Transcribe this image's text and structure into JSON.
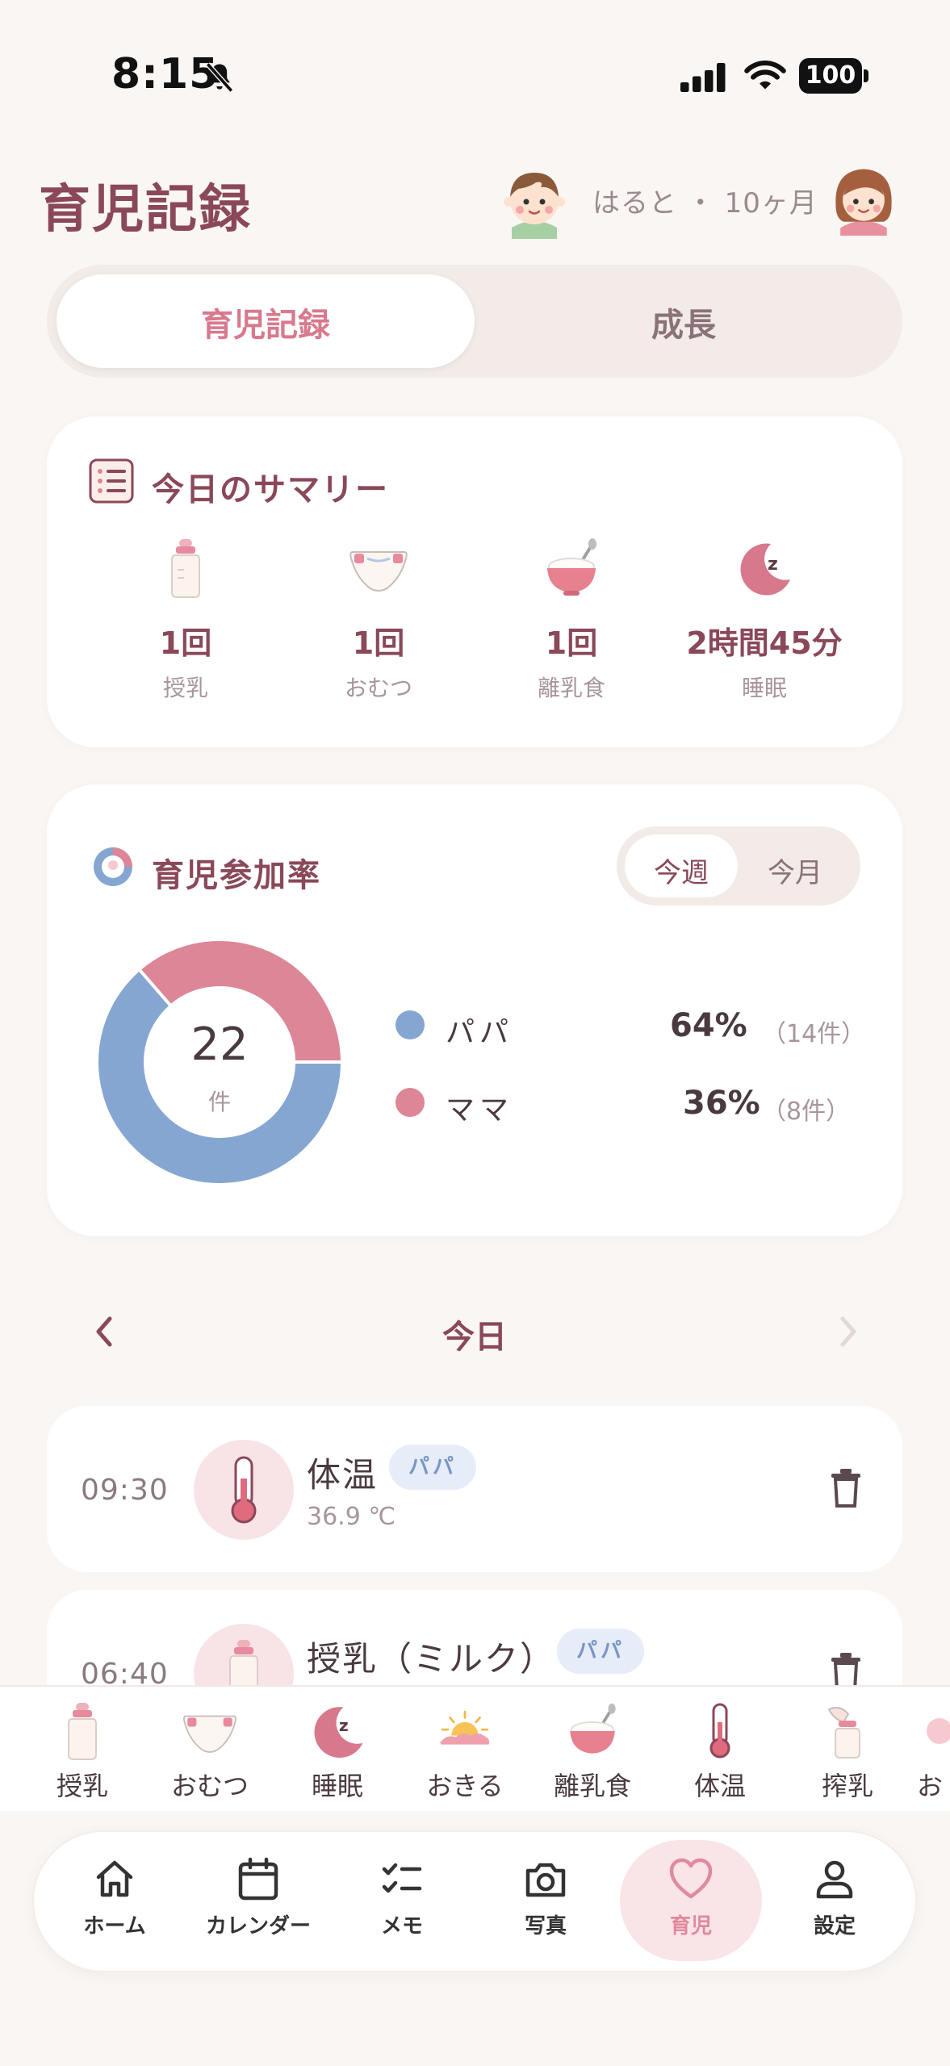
{
  "status_bar": {
    "time": "8:15",
    "battery": "100"
  },
  "header": {
    "title": "育児記録",
    "child_info": "はると ・ 10ヶ月"
  },
  "segment": {
    "active": "育児記録",
    "inactive": "成長"
  },
  "summary": {
    "title": "今日のサマリー",
    "items": [
      {
        "icon": "bottle-icon",
        "value": "1回",
        "label": "授乳"
      },
      {
        "icon": "diaper-icon",
        "value": "1回",
        "label": "おむつ"
      },
      {
        "icon": "baby-food-icon",
        "value": "1回",
        "label": "離乳食"
      },
      {
        "icon": "moon-sleep-icon",
        "value": "2時間45分",
        "label": "睡眠"
      }
    ]
  },
  "participation": {
    "title": "育児参加率",
    "toggle": {
      "week": "今週",
      "month": "今月",
      "selected": "今週"
    },
    "total": "22",
    "total_unit": "件",
    "legend": [
      {
        "name": "パパ",
        "pct": "64%",
        "count": "（14件）",
        "color": "#86a6d2"
      },
      {
        "name": "ママ",
        "pct": "36%",
        "count": "（8件）",
        "color": "#dc8698"
      }
    ]
  },
  "chart_data": {
    "type": "pie",
    "categories": [
      "パパ",
      "ママ"
    ],
    "values": [
      14,
      8
    ],
    "colors": [
      "#86a6d2",
      "#dc8698"
    ]
  },
  "date_nav": {
    "label": "今日"
  },
  "records": [
    {
      "time": "09:30",
      "title": "体温",
      "badge": "パパ",
      "sub": "36.9 ℃",
      "icon": "thermometer-icon"
    },
    {
      "time": "06:40",
      "title": "授乳（ミルク）",
      "badge": "パパ",
      "sub": "",
      "icon": "bottle-icon"
    }
  ],
  "quick_actions": [
    {
      "label": "授乳",
      "icon": "bottle-icon"
    },
    {
      "label": "おむつ",
      "icon": "diaper-icon"
    },
    {
      "label": "睡眠",
      "icon": "moon-sleep-icon"
    },
    {
      "label": "おきる",
      "icon": "sunrise-icon"
    },
    {
      "label": "離乳食",
      "icon": "baby-food-icon"
    },
    {
      "label": "体温",
      "icon": "thermometer-icon"
    },
    {
      "label": "搾乳",
      "icon": "breast-pump-icon"
    },
    {
      "label": "お",
      "icon": "partial-icon"
    }
  ],
  "tabs": [
    {
      "label": "ホーム",
      "icon": "home-icon"
    },
    {
      "label": "カレンダー",
      "icon": "calendar-icon"
    },
    {
      "label": "メモ",
      "icon": "checklist-icon"
    },
    {
      "label": "写真",
      "icon": "camera-icon"
    },
    {
      "label": "育児",
      "icon": "heart-icon",
      "active": true
    },
    {
      "label": "設定",
      "icon": "person-icon"
    }
  ],
  "colors": {
    "accent": "#8a4858",
    "pink": "#dc8698",
    "blue": "#86a6d2",
    "background": "#faf6f3"
  }
}
